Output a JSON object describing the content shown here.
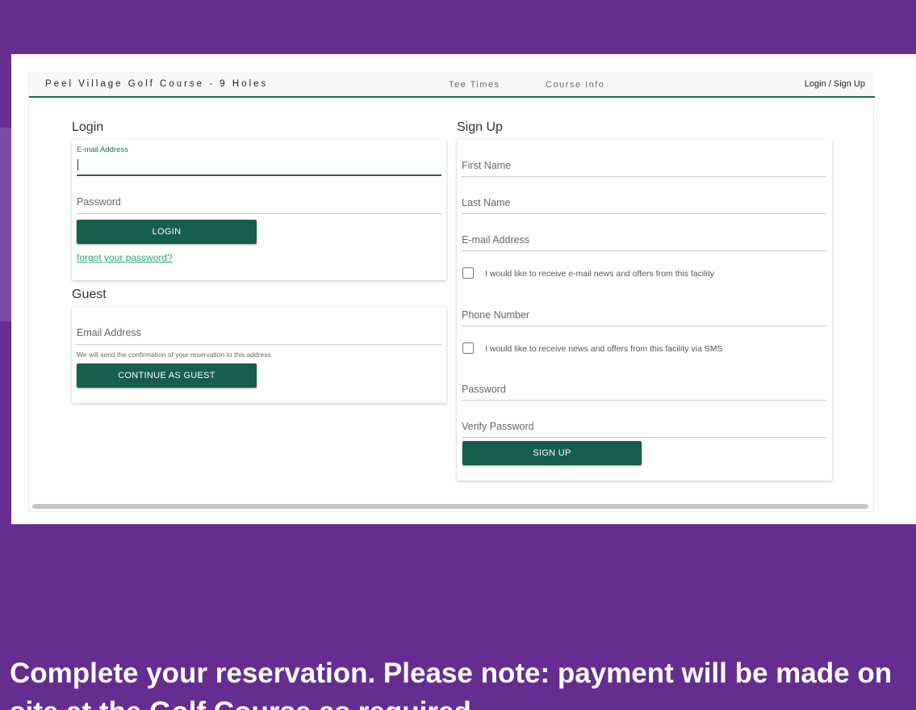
{
  "header": {
    "brand": "Peel Village Golf Course - 9 Holes",
    "nav": [
      "Tee Times",
      "Course Info"
    ],
    "login_link": "Login / Sign Up"
  },
  "login": {
    "title": "Login",
    "email_label": "E-mail Address",
    "email_value": "",
    "password_label": "Password",
    "button": "LOGIN",
    "forgot": "forgot your password?"
  },
  "guest": {
    "title": "Guest",
    "email_label": "Email Address",
    "hint": "We will send the confirmation of your reservation to this address",
    "button": "CONTINUE AS GUEST"
  },
  "signup": {
    "title": "Sign Up",
    "first_name": "First Name",
    "last_name": "Last Name",
    "email": "E-mail Address",
    "email_optin": "I would like to receive e-mail news and offers from this facility",
    "phone": "Phone Number",
    "sms_optin": "I would like to receive news and offers from this facility via SMS",
    "password": "Password",
    "verify_password": "Verify Password",
    "button": "SIGN UP"
  },
  "caption": "Complete your reservation. Please note: payment will be made on site at the Golf Course as required.",
  "colors": {
    "background": "#652d90",
    "accent": "#165e4d",
    "link": "#2fa77a"
  }
}
